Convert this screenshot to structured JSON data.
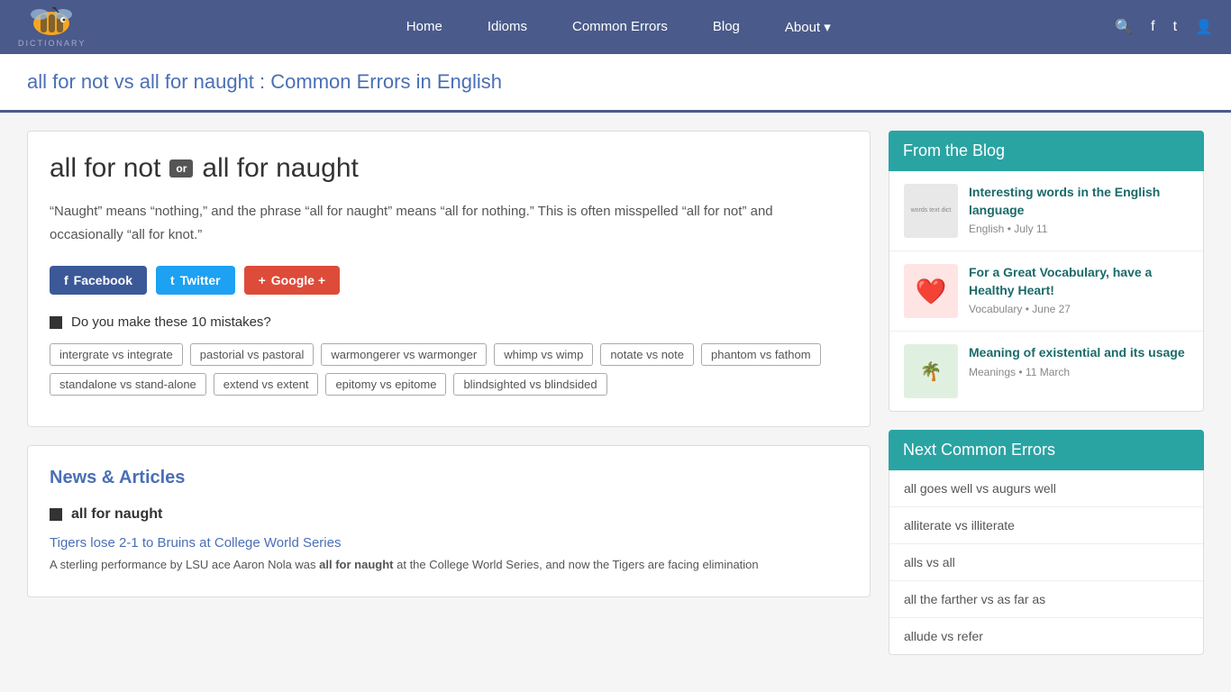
{
  "nav": {
    "logo_text": "BEE",
    "logo_sub": "DICTIONARY",
    "links": [
      {
        "label": "Home",
        "id": "home"
      },
      {
        "label": "Idioms",
        "id": "idioms"
      },
      {
        "label": "Common Errors",
        "id": "common-errors"
      },
      {
        "label": "Blog",
        "id": "blog"
      },
      {
        "label": "About ▾",
        "id": "about"
      }
    ]
  },
  "page": {
    "title": "all for not vs all for naught : Common Errors in English"
  },
  "main_card": {
    "word1": "all for not",
    "or_label": "or",
    "word2": "all for naught",
    "description": "“Naught” means “nothing,” and the phrase “all for naught” means “all for nothing.” This is often misspelled “all for not” and occasionally “all for knot.”",
    "share": {
      "facebook_label": "Facebook",
      "twitter_label": "Twitter",
      "google_label": "Google +"
    },
    "mistakes_question": "Do you make these 10 mistakes?",
    "tags": [
      "intergrate vs integrate",
      "pastorial vs pastoral",
      "warmongerer vs warmonger",
      "whimp vs wimp",
      "notate vs note",
      "phantom vs fathom",
      "standalone vs stand-alone",
      "extend vs extent",
      "epitomy vs epitome",
      "blindsighted vs blindsided"
    ]
  },
  "news_card": {
    "section_title": "News & Articles",
    "sub_header": "all for naught",
    "article_title": "Tigers lose 2-1 to Bruins at College World Series",
    "article_text": "A sterling performance by LSU ace Aaron Nola was all for naught at the College World Series, and now the Tigers are facing elimination"
  },
  "sidebar": {
    "blog_header": "From the Blog",
    "blog_items": [
      {
        "title": "Interesting words in the English language",
        "category": "English",
        "date": "July 11",
        "thumb_type": "words"
      },
      {
        "title": "For a Great Vocabulary, have a Healthy Heart!",
        "category": "Vocabulary",
        "date": "June 27",
        "thumb_type": "heart"
      },
      {
        "title": "Meaning of existential and its usage",
        "category": "Meanings",
        "date": "11 March",
        "thumb_type": "existential"
      }
    ],
    "next_errors_header": "Next Common Errors",
    "next_errors": [
      "all goes well vs augurs well",
      "alliterate vs illiterate",
      "alls vs all",
      "all the farther vs as far as",
      "allude vs refer"
    ]
  }
}
